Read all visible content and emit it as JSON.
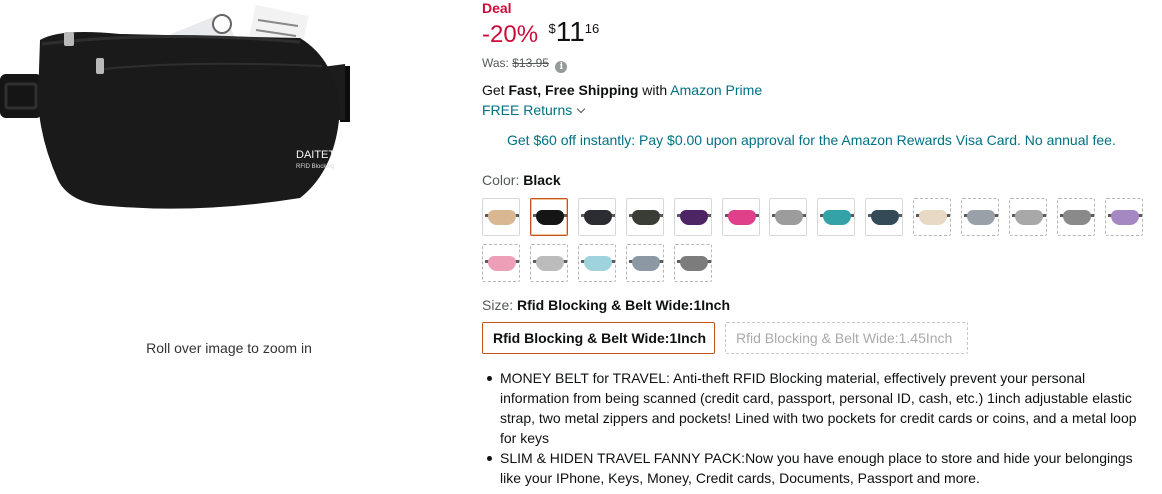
{
  "image": {
    "brand_text": "DAITET",
    "brand_subtext": "RFID Blocking",
    "zoom_hint": "Roll over image to zoom in"
  },
  "offer": {
    "badge": "Deal",
    "discount": "-20%",
    "currency": "$",
    "price_whole": "11",
    "price_fraction": "16",
    "was_label": "Was:",
    "was_price": "$13.95",
    "info_icon": "info-icon"
  },
  "shipping": {
    "get": "Get",
    "fast_free": "Fast, Free Shipping",
    "with": "with",
    "prime_link": "Amazon Prime",
    "returns": "FREE Returns"
  },
  "promo": {
    "text": "Get $60 off instantly: Pay $0.00 upon approval for the Amazon Rewards Visa Card. No annual fee."
  },
  "color": {
    "label": "Color:",
    "selected": "Black",
    "swatches": [
      {
        "color": "#d8b792",
        "available": true,
        "selected": false
      },
      {
        "color": "#151515",
        "available": true,
        "selected": true
      },
      {
        "color": "#2b2d33",
        "available": true,
        "selected": false
      },
      {
        "color": "#3a3d36",
        "available": true,
        "selected": false
      },
      {
        "color": "#4d2464",
        "available": true,
        "selected": false
      },
      {
        "color": "#e0408a",
        "available": true,
        "selected": false
      },
      {
        "color": "#9c9c9c",
        "available": true,
        "selected": false
      },
      {
        "color": "#34a3a8",
        "available": true,
        "selected": false
      },
      {
        "color": "#344a57",
        "available": true,
        "selected": false
      },
      {
        "color": "#e7d9c4",
        "available": false,
        "selected": false
      },
      {
        "color": "#9aa0a8",
        "available": false,
        "selected": false
      },
      {
        "color": "#a8a8a8",
        "available": false,
        "selected": false
      },
      {
        "color": "#8a8a8a",
        "available": false,
        "selected": false
      },
      {
        "color": "#a588c2",
        "available": false,
        "selected": false
      },
      {
        "color": "#ec9fb6",
        "available": false,
        "selected": false
      },
      {
        "color": "#bcbcbc",
        "available": false,
        "selected": false
      },
      {
        "color": "#9fd4dc",
        "available": false,
        "selected": false
      },
      {
        "color": "#8c98a4",
        "available": false,
        "selected": false
      },
      {
        "color": "#7c7c7c",
        "available": false,
        "selected": false
      }
    ]
  },
  "size": {
    "label": "Size:",
    "selected": "Rfid Blocking & Belt Wide:1Inch",
    "options": [
      {
        "label": "Rfid Blocking & Belt Wide:1Inch",
        "available": true
      },
      {
        "label": "Rfid Blocking & Belt Wide:1.45Inch",
        "available": false
      }
    ]
  },
  "bullets": [
    "MONEY BELT for TRAVEL: Anti-theft RFID Blocking material, effectively prevent your personal information from being scanned (credit card, passport, personal ID, cash, etc.) 1inch adjustable elastic strap, two metal zippers and pockets! Lined with two pockets for credit cards or coins, and a metal loop for keys",
    "SLIM & HIDEN TRAVEL FANNY PACK:Now you have enough place to store and hide your belongings like your IPhone, Keys, Money, Credit cards, Documents, Passport and more."
  ]
}
